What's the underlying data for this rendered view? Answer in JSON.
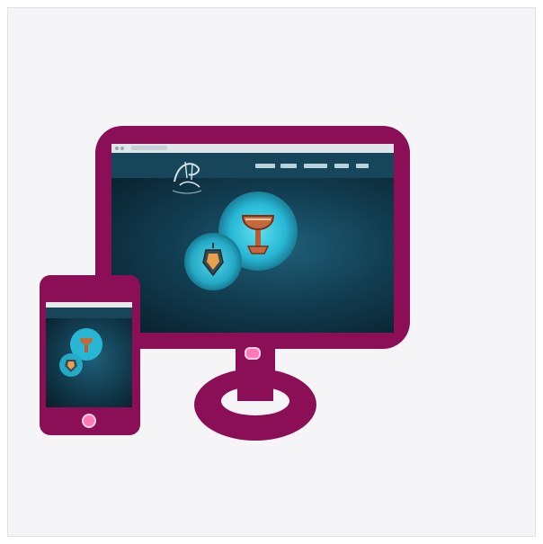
{
  "scene": {
    "description_free": true,
    "devices": [
      "desktop-monitor",
      "tablet"
    ],
    "colors": {
      "background": "#f5f5f7",
      "device_frame": "#8a0f57",
      "screen_dark": "#0b2c3a",
      "header": "#17465b",
      "circle_glow": "#27b7d4",
      "home_button": "#ff7ab5"
    },
    "icons": {
      "lantern": "lantern-icon",
      "goblet": "goblet-icon",
      "logo": "calligraphy-logo-icon"
    }
  }
}
